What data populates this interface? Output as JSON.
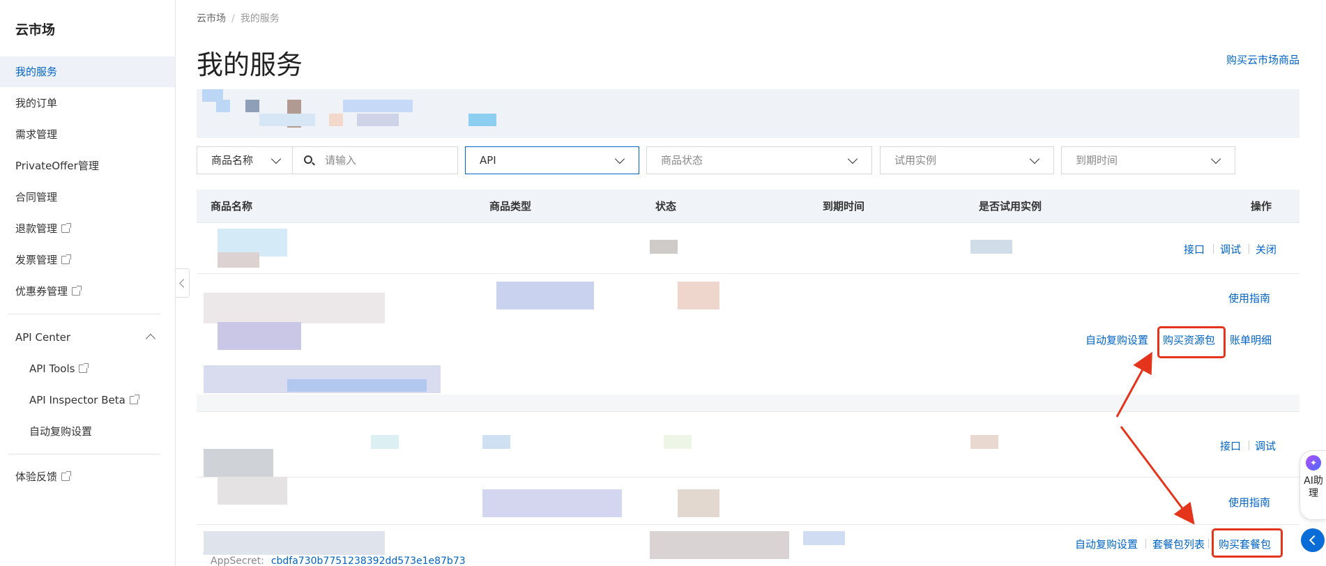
{
  "sidebar": {
    "brand": "云市场",
    "items": [
      {
        "label": "我的服务"
      },
      {
        "label": "我的订单"
      },
      {
        "label": "需求管理"
      },
      {
        "label": "PrivateOffer管理"
      },
      {
        "label": "合同管理"
      },
      {
        "label": "退款管理"
      },
      {
        "label": "发票管理"
      },
      {
        "label": "优惠券管理"
      }
    ],
    "api_center": {
      "label": "API Center",
      "children": [
        {
          "label": "API Tools"
        },
        {
          "label": "API Inspector Beta"
        },
        {
          "label": "自动复购设置"
        }
      ]
    },
    "feedback": "体验反馈"
  },
  "breadcrumb": {
    "root": "云市场",
    "current": "我的服务"
  },
  "page": {
    "title": "我的服务",
    "buy_link": "购买云市场商品"
  },
  "filters": {
    "field_select": "商品名称",
    "search_placeholder": "请输入",
    "type_select": "API",
    "status_placeholder": "商品状态",
    "trial_placeholder": "试用实例",
    "expiry_placeholder": "到期时间"
  },
  "table": {
    "headers": [
      "商品名称",
      "商品类型",
      "状态",
      "到期时间",
      "是否试用实例",
      "操作"
    ],
    "row1": {
      "actions_top": [
        "接口",
        "调试",
        "关闭"
      ],
      "guide": "使用指南",
      "actions_bottom": [
        "自动复购设置",
        "购买资源包",
        "账单明细"
      ]
    },
    "row2": {
      "actions_top": [
        "接口",
        "调试"
      ],
      "guide": "使用指南",
      "actions_bottom": [
        "自动复购设置",
        "套餐包列表",
        "购买套餐包"
      ]
    },
    "secret_label": "AppSecret:",
    "secret_value": "cbdfa730b7751238392dd573e1e87b73"
  },
  "assistant": {
    "icon": "sparkle-icon",
    "label": "AI助理"
  },
  "colors": {
    "accent": "#0064c8",
    "highlight": "#e5341c"
  }
}
